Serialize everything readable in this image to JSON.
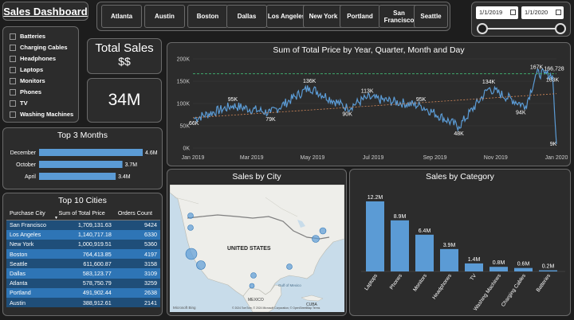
{
  "header": {
    "title": "Sales Dashboard"
  },
  "city_slicer": [
    "Atlanta",
    "Austin",
    "Boston",
    "Dallas",
    "Los Angeles",
    "New York",
    "Portland",
    "San Francisco",
    "Seattle"
  ],
  "date_range": {
    "start": "1/1/2019",
    "end": "1/1/2020"
  },
  "product_filter": [
    "Batteries",
    "Charging Cables",
    "Headphones",
    "Laptops",
    "Monitors",
    "Phones",
    "TV",
    "Washing Machines"
  ],
  "kpi": {
    "title": "Total Sales",
    "subtitle": "$$",
    "value": "34M"
  },
  "top_months": {
    "title": "Top 3 Months",
    "items": [
      {
        "label": "December",
        "value": 4.6,
        "value_label": "4.6M"
      },
      {
        "label": "October",
        "value": 3.7,
        "value_label": "3.7M"
      },
      {
        "label": "April",
        "value": 3.4,
        "value_label": "3.4M"
      }
    ]
  },
  "top_cities": {
    "title": "Top 10 Cities",
    "columns": [
      "Purchase City",
      "Sum of Total Price",
      "Orders Count"
    ],
    "rows": [
      [
        "San Francisco",
        "1,709,131.63",
        "9424"
      ],
      [
        "Los Angeles",
        "1,140,717.18",
        "6330"
      ],
      [
        "New York",
        "1,000,919.51",
        "5360"
      ],
      [
        "Boston",
        "764,413.85",
        "4197"
      ],
      [
        "Seattle",
        "611,600.87",
        "3158"
      ],
      [
        "Dallas",
        "583,123.77",
        "3109"
      ],
      [
        "Atlanta",
        "578,750.79",
        "3259"
      ],
      [
        "Portland",
        "491,902.44",
        "2638"
      ],
      [
        "Austin",
        "388,912.61",
        "2141"
      ]
    ]
  },
  "line_chart": {
    "title": "Sum of Total Price by Year, Quarter, Month and Day",
    "y_ticks": [
      "200K",
      "150K",
      "100K",
      "50K",
      "0K"
    ],
    "x_ticks": [
      "Jan 2019",
      "Mar 2019",
      "May 2019",
      "Jul 2019",
      "Sep 2019",
      "Nov 2019",
      "Jan 2020"
    ],
    "annotations": [
      "66K",
      "95K",
      "79K",
      "136K",
      "90K",
      "113K",
      "95K",
      "48K",
      "134K",
      "94K",
      "167K",
      "166,728",
      "163K",
      "9K"
    ]
  },
  "map": {
    "title": "Sales by City",
    "country_label": "UNITED STATES",
    "labels": [
      "MEXICO",
      "CUBA",
      "Gulf of Mexico"
    ],
    "brand": "Microsoft Bing",
    "copyright": "© 2024 TomTom, © 2024 Microsoft Corporation, © OpenStreetMap Terms"
  },
  "category_chart": {
    "title": "Sales by Category",
    "categories": [
      "Laptops",
      "Phones",
      "Monitors",
      "Headphones",
      "TV",
      "Washing Machines",
      "Charging Cables",
      "Batteries"
    ],
    "values": [
      12.2,
      8.9,
      6.4,
      3.9,
      1.4,
      0.8,
      0.6,
      0.2
    ],
    "value_labels": [
      "12.2M",
      "8.9M",
      "6.4M",
      "3.9M",
      "1.4M",
      "0.8M",
      "0.6M",
      "0.2M"
    ]
  },
  "chart_data": [
    {
      "type": "line",
      "title": "Sum of Total Price by Year, Quarter, Month and Day",
      "x_range": [
        "2019-01-01",
        "2020-01-01"
      ],
      "ylim": [
        0,
        200000
      ],
      "key_points": [
        {
          "x": "2019-01-02",
          "y": 66000
        },
        {
          "x": "2019-02-10",
          "y": 95000
        },
        {
          "x": "2019-03-20",
          "y": 79000
        },
        {
          "x": "2019-04-28",
          "y": 136000
        },
        {
          "x": "2019-06-05",
          "y": 90000
        },
        {
          "x": "2019-06-25",
          "y": 113000
        },
        {
          "x": "2019-08-18",
          "y": 95000
        },
        {
          "x": "2019-09-25",
          "y": 48000
        },
        {
          "x": "2019-10-25",
          "y": 134000
        },
        {
          "x": "2019-12-01",
          "y": 94000
        },
        {
          "x": "2019-12-12",
          "y": 167000
        },
        {
          "x": "2019-12-20",
          "y": 166728
        },
        {
          "x": "2019-12-28",
          "y": 163000
        },
        {
          "x": "2020-01-01",
          "y": 9000
        }
      ]
    },
    {
      "type": "bar",
      "title": "Sales by Category",
      "categories": [
        "Laptops",
        "Phones",
        "Monitors",
        "Headphones",
        "TV",
        "Washing Machines",
        "Charging Cables",
        "Batteries"
      ],
      "values": [
        12.2,
        8.9,
        6.4,
        3.9,
        1.4,
        0.8,
        0.6,
        0.2
      ]
    },
    {
      "type": "bar",
      "title": "Top 3 Months",
      "categories": [
        "December",
        "October",
        "April"
      ],
      "values": [
        4.6,
        3.7,
        3.4
      ]
    }
  ]
}
